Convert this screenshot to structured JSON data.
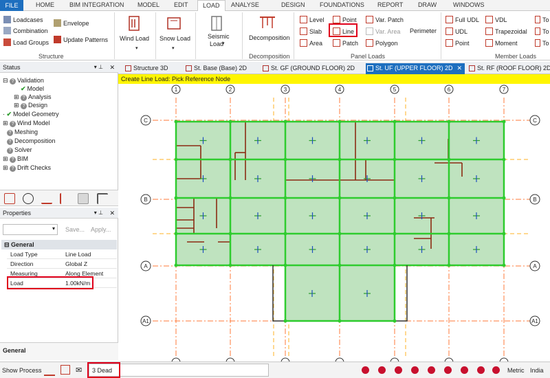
{
  "menu": {
    "file": "FILE",
    "items": [
      "HOME",
      "BIM INTEGRATION",
      "MODEL",
      "EDIT",
      "LOAD",
      "ANALYSE",
      "DESIGN",
      "FOUNDATIONS",
      "REPORT",
      "DRAW",
      "WINDOWS"
    ]
  },
  "ribbon": {
    "structure": {
      "loadcases": "Loadcases",
      "combination": "Combination",
      "load_groups": "Load Groups",
      "envelope": "Envelope",
      "update_patterns": "Update Patterns",
      "group": "Structure"
    },
    "wind_load": "Wind Load",
    "snow_load": "Snow Load",
    "seismic_load_1": "Seismic",
    "seismic_load_2": "Load",
    "decomposition": {
      "label": "Decomposition",
      "group": "Decomposition"
    },
    "panel": {
      "level": "Level",
      "slab": "Slab",
      "area": "Area",
      "point": "Point",
      "line": "Line",
      "patch": "Patch",
      "var_patch": "Var. Patch",
      "var_area": "Var. Area",
      "polygon": "Polygon",
      "perimeter": "Perimeter",
      "group": "Panel Loads"
    },
    "member": {
      "full_udl": "Full UDL",
      "udl": "UDL",
      "point": "Point",
      "vdl": "VDL",
      "trapezoidal": "Trapezoidal",
      "moment": "Moment",
      "to1": "To",
      "to2": "To",
      "to3": "To",
      "group": "Member Loads"
    }
  },
  "status": {
    "title": "Status",
    "tree": [
      "Validation",
      "Model",
      "Analysis",
      "Design",
      "Model Geometry",
      "Wind Model",
      "Meshing",
      "Decomposition",
      "Solver",
      "BIM",
      "Drift Checks"
    ]
  },
  "properties": {
    "title": "Properties",
    "save": "Save...",
    "apply": "Apply...",
    "section": "General",
    "rows": [
      {
        "k": "Load Type",
        "v": "Line Load"
      },
      {
        "k": "Direction",
        "v": "Global Z"
      },
      {
        "k": "Measuring",
        "v": "Along Element"
      },
      {
        "k": "Load",
        "v": "1.00kN/m"
      }
    ]
  },
  "general_panel": "General",
  "tabs": [
    "Structure 3D",
    "St. Base (Base) 2D",
    "St. GF (GROUND FLOOR) 2D",
    "St. UF (UPPER FLOOR) 2D",
    "St. RF (ROOF FLOOR) 2D"
  ],
  "banner": "Create Line Load: Pick Reference Node",
  "grid": {
    "columns": [
      "1",
      "2",
      "3",
      "4",
      "5",
      "6",
      "7"
    ],
    "rows": [
      "C",
      "B",
      "A",
      "A1"
    ]
  },
  "bottom": {
    "show_process": "Show Process",
    "loadcase": "3 Dead",
    "units": "Metric",
    "region": "India"
  },
  "colors": {
    "accent": "#1e6fbf",
    "highlight": "#e0001b",
    "banner": "#fff500",
    "slab": "#bfe3bf",
    "beam": "#2ecc2e",
    "wall": "#8b2a12"
  }
}
